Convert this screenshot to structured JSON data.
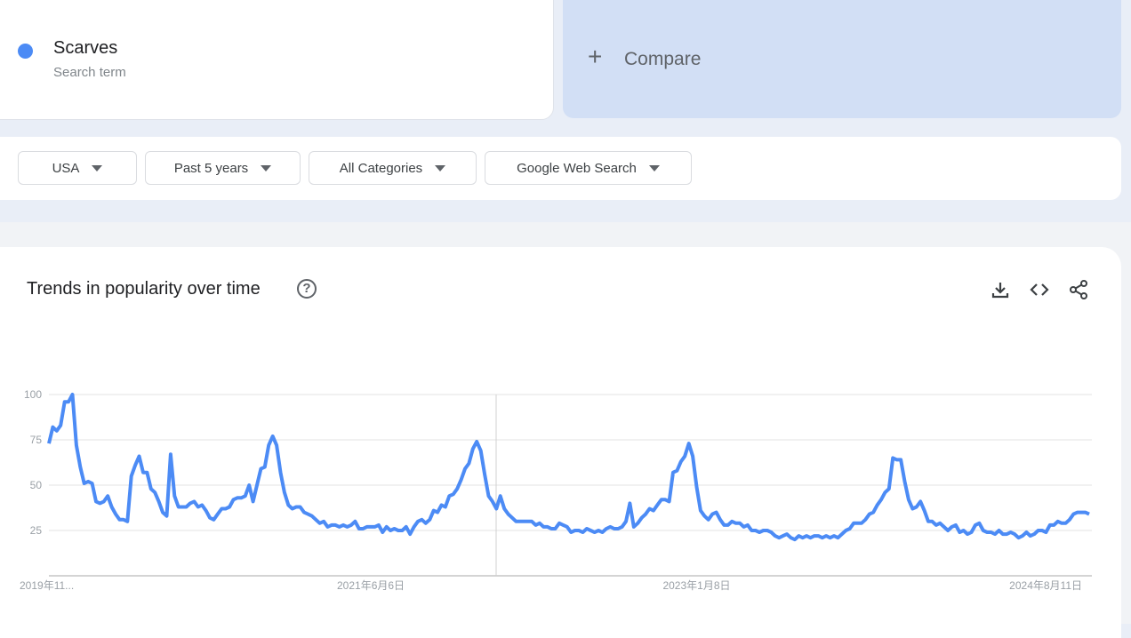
{
  "search_term": {
    "name": "Scarves",
    "subtitle": "Search term",
    "color": "#4c8bf5"
  },
  "compare": {
    "label": "Compare",
    "icon": "plus-icon"
  },
  "filters": [
    {
      "label": "USA"
    },
    {
      "label": "Past 5 years"
    },
    {
      "label": "All Categories"
    },
    {
      "label": "Google Web Search"
    }
  ],
  "chart_card": {
    "title": "Trends in popularity over time",
    "help_icon": "help-circle-icon",
    "actions": [
      "download-icon",
      "embed-code-icon",
      "share-icon"
    ]
  },
  "chart_data": {
    "type": "line",
    "frequency": "weekly",
    "ylim": [
      0,
      100
    ],
    "y_ticks": [
      25,
      50,
      75,
      100
    ],
    "grid": true,
    "line_color": "#4c8bf5",
    "x_ticks": [
      {
        "label": "2019年11...",
        "date": "2019-11-10"
      },
      {
        "label": "2021年6月6日",
        "date": "2021-06-06"
      },
      {
        "label": "2023年1月8日",
        "date": "2023-01-08"
      },
      {
        "label": "2024年8月11日",
        "date": "2024-08-11"
      }
    ],
    "values": [
      73,
      82,
      80,
      83,
      96,
      96,
      100,
      72,
      60,
      51,
      52,
      51,
      41,
      40,
      41,
      44,
      38,
      34,
      31,
      31,
      30,
      55,
      61,
      66,
      57,
      57,
      48,
      46,
      41,
      35,
      33,
      67,
      44,
      38,
      38,
      38,
      40,
      41,
      38,
      39,
      36,
      32,
      31,
      34,
      37,
      37,
      38,
      42,
      43,
      43,
      44,
      50,
      41,
      50,
      59,
      60,
      72,
      77,
      72,
      57,
      46,
      39,
      37,
      38,
      38,
      35,
      34,
      33,
      31,
      29,
      30,
      27,
      28,
      28,
      27,
      28,
      27,
      28,
      30,
      26,
      26,
      27,
      27,
      27,
      28,
      24,
      27,
      25,
      26,
      25,
      25,
      27,
      23,
      27,
      30,
      31,
      29,
      31,
      36,
      35,
      39,
      38,
      44,
      45,
      48,
      53,
      59,
      62,
      70,
      74,
      69,
      56,
      44,
      41,
      37,
      44,
      37,
      34,
      32,
      30,
      30,
      30,
      30,
      30,
      28,
      29,
      27,
      27,
      26,
      26,
      29,
      28,
      27,
      24,
      25,
      25,
      24,
      26,
      25,
      24,
      25,
      24,
      26,
      27,
      26,
      26,
      27,
      30,
      40,
      27,
      29,
      32,
      34,
      37,
      36,
      39,
      42,
      42,
      41,
      57,
      58,
      63,
      66,
      73,
      66,
      49,
      36,
      33,
      31,
      34,
      35,
      31,
      28,
      28,
      30,
      29,
      29,
      27,
      28,
      25,
      25,
      24,
      25,
      25,
      24,
      22,
      21,
      22,
      23,
      21,
      20,
      22,
      21,
      22,
      21,
      22,
      22,
      21,
      22,
      21,
      22,
      21,
      23,
      25,
      26,
      29,
      29,
      29,
      31,
      34,
      35,
      39,
      42,
      46,
      48,
      65,
      64,
      64,
      52,
      42,
      37,
      38,
      41,
      36,
      30,
      30,
      28,
      29,
      27,
      25,
      27,
      28,
      24,
      25,
      23,
      24,
      28,
      29,
      25,
      24,
      24,
      23,
      25,
      23,
      23,
      24,
      23,
      21,
      22,
      24,
      22,
      23,
      25,
      25,
      24,
      28,
      28,
      30,
      29,
      29,
      31,
      34,
      35,
      35,
      35,
      34
    ]
  }
}
